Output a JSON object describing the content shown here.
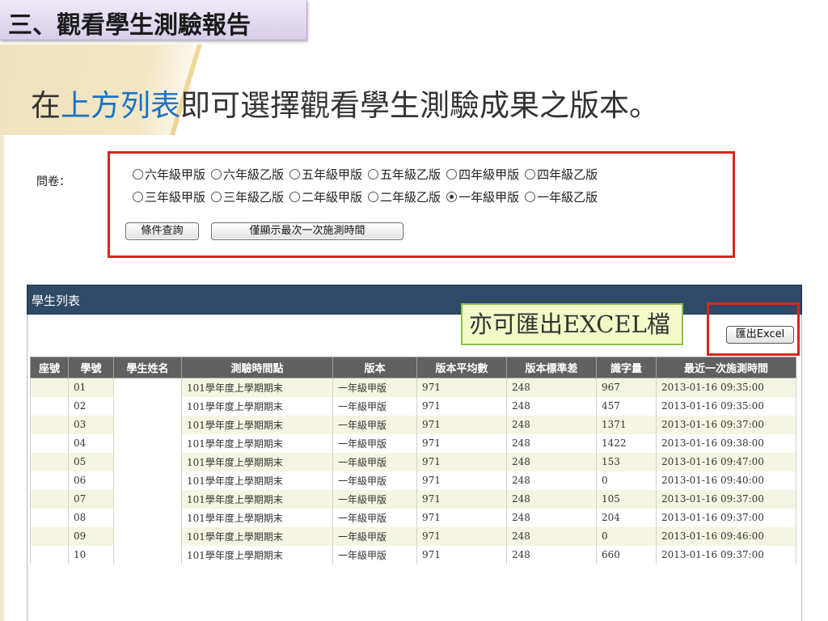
{
  "slide_title": "三、觀看學生測驗報告",
  "heading": {
    "prefix": "在",
    "highlight": "上方列表",
    "suffix": "即可選擇觀看學生測驗成果之版本。"
  },
  "questionnaire": {
    "label": "問卷：",
    "row1": [
      {
        "label": "六年級甲版",
        "selected": false
      },
      {
        "label": "六年級乙版",
        "selected": false
      },
      {
        "label": "五年級甲版",
        "selected": false
      },
      {
        "label": "五年級乙版",
        "selected": false
      },
      {
        "label": "四年級甲版",
        "selected": false
      },
      {
        "label": "四年級乙版",
        "selected": false
      }
    ],
    "row2": [
      {
        "label": "三年級甲版",
        "selected": false
      },
      {
        "label": "三年級乙版",
        "selected": false
      },
      {
        "label": "二年級甲版",
        "selected": false
      },
      {
        "label": "二年級乙版",
        "selected": false
      },
      {
        "label": "一年級甲版",
        "selected": true
      },
      {
        "label": "一年級乙版",
        "selected": false
      }
    ],
    "query_button": "條件查詢",
    "latest_button": "僅顯示最次一次施測時間"
  },
  "panel": {
    "title": "學生列表",
    "callout": "亦可匯出EXCEL檔",
    "export_button": "匯出Excel"
  },
  "colors": {
    "title_tab": "#d8cdea",
    "highlight": "#1a73c7",
    "frame_red": "#d8261e",
    "panel_header": "#2f4a66",
    "callout_bg": "#f3fac8"
  },
  "table": {
    "headers": [
      "座號",
      "學號",
      "學生姓名",
      "測驗時間點",
      "版本",
      "版本平均數",
      "版本標準差",
      "識字量",
      "最近一次施測時間"
    ],
    "rows": [
      [
        "",
        "01",
        "",
        "101學年度上學期期末",
        "一年級甲版",
        "971",
        "248",
        "967",
        "2013-01-16 09:35:00"
      ],
      [
        "",
        "02",
        "",
        "101學年度上學期期末",
        "一年級甲版",
        "971",
        "248",
        "457",
        "2013-01-16 09:35:00"
      ],
      [
        "",
        "03",
        "",
        "101學年度上學期期末",
        "一年級甲版",
        "971",
        "248",
        "1371",
        "2013-01-16 09:37:00"
      ],
      [
        "",
        "04",
        "",
        "101學年度上學期期末",
        "一年級甲版",
        "971",
        "248",
        "1422",
        "2013-01-16 09:38:00"
      ],
      [
        "",
        "05",
        "",
        "101學年度上學期期末",
        "一年級甲版",
        "971",
        "248",
        "153",
        "2013-01-16 09:47:00"
      ],
      [
        "",
        "06",
        "",
        "101學年度上學期期末",
        "一年級甲版",
        "971",
        "248",
        "0",
        "2013-01-16 09:40:00"
      ],
      [
        "",
        "07",
        "",
        "101學年度上學期期末",
        "一年級甲版",
        "971",
        "248",
        "105",
        "2013-01-16 09:37:00"
      ],
      [
        "",
        "08",
        "",
        "101學年度上學期期末",
        "一年級甲版",
        "971",
        "248",
        "204",
        "2013-01-16 09:37:00"
      ],
      [
        "",
        "09",
        "",
        "101學年度上學期期末",
        "一年級甲版",
        "971",
        "248",
        "0",
        "2013-01-16 09:46:00"
      ],
      [
        "",
        "10",
        "",
        "101學年度上學期期末",
        "一年級甲版",
        "971",
        "248",
        "660",
        "2013-01-16 09:37:00"
      ]
    ]
  }
}
